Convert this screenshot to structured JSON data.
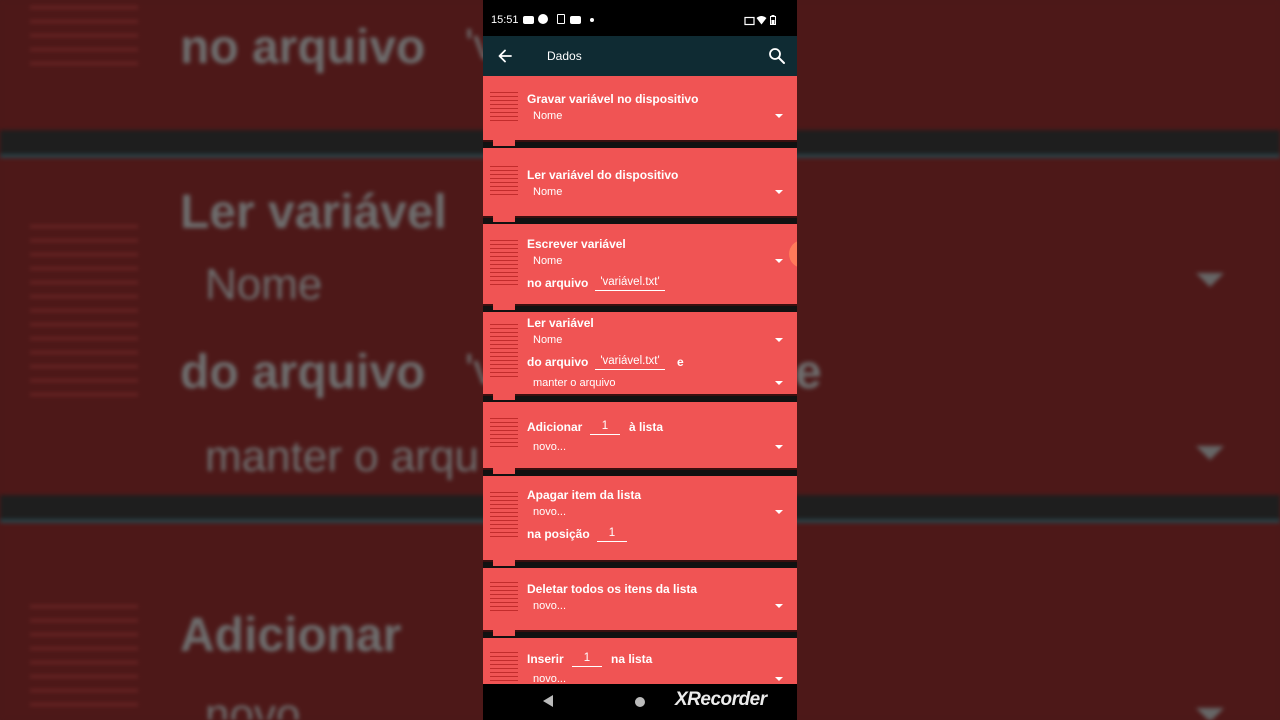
{
  "status_bar": {
    "time": "15:51"
  },
  "app_bar": {
    "title": "Dados"
  },
  "blocks": {
    "gravar": {
      "title": "Gravar variável no dispositivo",
      "dropdown": "Nome"
    },
    "ler_disp": {
      "title": "Ler variável do dispositivo",
      "dropdown": "Nome"
    },
    "escrever": {
      "title": "Escrever variável",
      "dropdown": "Nome",
      "label": "no arquivo",
      "file": "'variável.txt'"
    },
    "ler": {
      "title": "Ler variável",
      "dropdown": "Nome",
      "label": "do arquivo",
      "file": "'variável.txt'",
      "suffix": "e",
      "mode": "manter o arquivo"
    },
    "adicionar": {
      "title": "Adicionar",
      "value": "1",
      "suffix": "à lista",
      "dropdown": "novo..."
    },
    "apagar": {
      "title": "Apagar item da lista",
      "dropdown": "novo...",
      "label": "na posição",
      "value": "1"
    },
    "deletar": {
      "title": "Deletar todos os itens da lista",
      "dropdown": "novo..."
    },
    "inserir": {
      "title": "Inserir",
      "value": "1",
      "suffix": "na lista",
      "dropdown": "novo..."
    }
  },
  "background": {
    "line1": "no arquivo",
    "line1b": "'v",
    "line2": "Ler variável",
    "line3": "Nome",
    "line4": "do arquivo",
    "line4b": "'v",
    "line4c": "e",
    "line5": "manter o arqu",
    "line6": "Adicionar",
    "line7": "novo"
  },
  "watermark": "XRecorder",
  "colors": {
    "block": "#f05454",
    "app_bar": "#0f2b33",
    "background": "#4d1818"
  }
}
